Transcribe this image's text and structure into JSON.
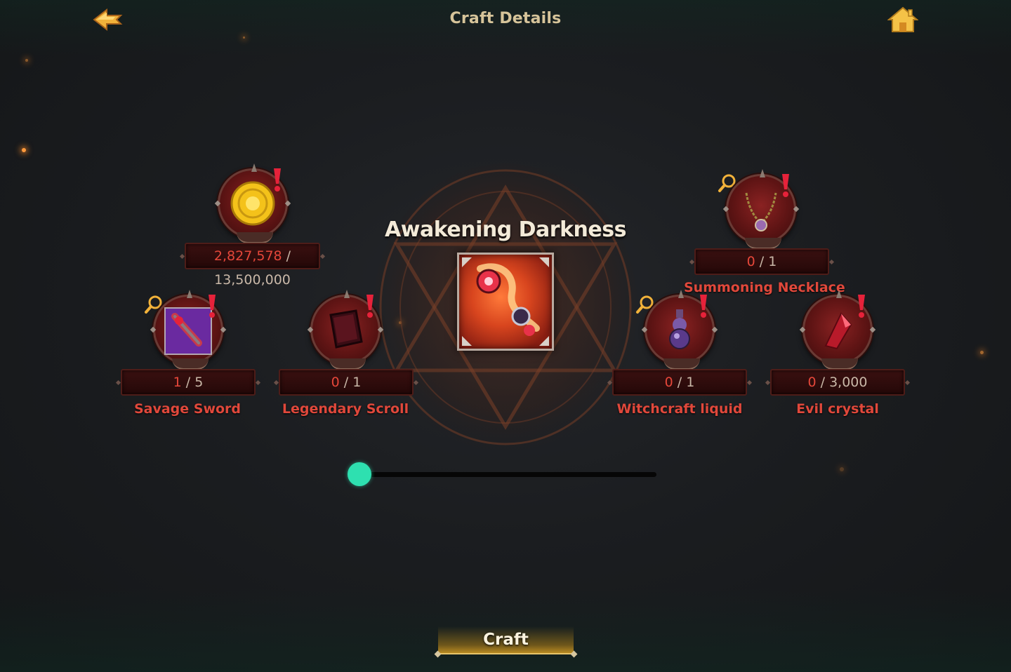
{
  "header": {
    "title": "Craft Details",
    "back_icon": "back-arrow-icon",
    "home_icon": "home-icon"
  },
  "product": {
    "name": "Awakening Darkness",
    "icon": "awakening-darkness-weapon-icon"
  },
  "gold": {
    "have": "2,827,578",
    "separator": " / ",
    "need": "13,500,000",
    "icon": "gold-coin-icon"
  },
  "materials": [
    {
      "name": "Savage Sword",
      "have": "1",
      "need": "5",
      "icon": "savage-sword-icon"
    },
    {
      "name": "Legendary Scroll",
      "have": "0",
      "need": "1",
      "icon": "legendary-scroll-icon"
    },
    {
      "name": "Summoning Necklace",
      "have": "0",
      "need": "1",
      "icon": "necklace-icon"
    },
    {
      "name": "Witchcraft liquid",
      "have": "0",
      "need": "1",
      "icon": "potion-icon"
    },
    {
      "name": "Evil crystal",
      "have": "0",
      "need": "3,000",
      "icon": "crystal-icon"
    }
  ],
  "separator": " / ",
  "slider": {
    "value_fraction": 0.0
  },
  "craft_button": {
    "label": "Craft"
  },
  "colors": {
    "accent_red": "#e0483b",
    "title_gold": "#d7c49a",
    "slider_thumb": "#2ee0b0",
    "alert_red": "#e6223a"
  }
}
